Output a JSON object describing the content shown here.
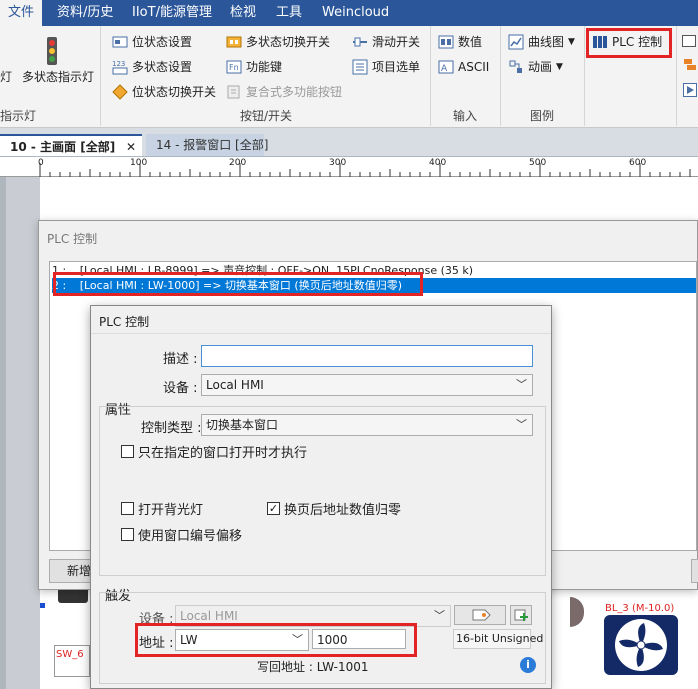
{
  "menu": {
    "items": [
      "文件",
      "资料/历史",
      "IIoT/能源管理",
      "检视",
      "工具",
      "Weincloud"
    ]
  },
  "ribbon": {
    "lamp_label": "多状态指示灯",
    "lamp_group_label": "指示灯",
    "buttons": {
      "bit_set": "位状态设置",
      "word_set": "多状态设置",
      "bit_toggle": "位状态切换开关",
      "multi_switch": "多状态切换开关",
      "function_key": "功能键",
      "combo_button": "复合式多功能按钮",
      "slide_switch": "滑动开关",
      "item_list": "项目选单"
    },
    "buttons_group_label": "按钮/开关",
    "input": {
      "numeric": "数值",
      "ascii": "ASCII",
      "group_label": "输入"
    },
    "chart": {
      "trend": "曲线图",
      "anim": "动画",
      "group_label": "图例"
    },
    "plc_control": "PLC 控制"
  },
  "tabs": {
    "main": "10 - 主画面 [全部]",
    "close": "✕",
    "alarm": "14 - 报警窗口 [全部]"
  },
  "ruler": {
    "ticks": [
      "0",
      "100",
      "200",
      "300",
      "400",
      "500",
      "600"
    ]
  },
  "plc_list_dialog": {
    "title": "PLC 控制",
    "rows": [
      {
        "index": "1 :",
        "text": "[Local HMI : LB-8999] => 声音控制 : OFF->ON, 15PLCnoResponse (35 k)"
      },
      {
        "index": "2 :",
        "text": "[Local HMI : LW-1000] => 切换基本窗口 (换页后地址数值归零)"
      }
    ],
    "new_button": "新增"
  },
  "plc_edit_dialog": {
    "title": "PLC 控制",
    "description_label": "描述 :",
    "description_value": "",
    "device_label": "设备 :",
    "device_value": "Local HMI",
    "attributes_label": "属性",
    "control_type_label": "控制类型 :",
    "control_type_value": "切换基本窗口",
    "cb_only_window_open": "只在指定的窗口打开时才执行",
    "cb_backlight": "打开背光灯",
    "cb_reset_after_switch": "换页后地址数值归零",
    "cb_window_offset": "使用窗口编号偏移",
    "trigger_label": "触发",
    "trigger_device_label": "设备 :",
    "trigger_device_value": "Local HMI",
    "address_label": "地址 :",
    "address_type": "LW",
    "address_value": "1000",
    "data_format": "16-bit Unsigned",
    "writeback_label": "写回地址 :",
    "writeback_value": "LW-1001",
    "info_icon": "i"
  },
  "canvas_labels": {
    "sw6": "SW_6",
    "bl3": "BL_3 (M-10.0)"
  }
}
